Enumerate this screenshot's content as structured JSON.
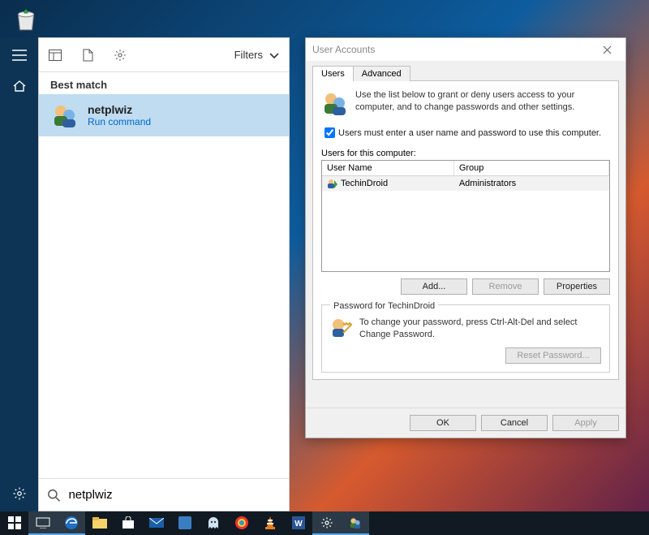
{
  "search": {
    "filters_label": "Filters",
    "best_match_label": "Best match",
    "result_title": "netplwiz",
    "result_sub": "Run command",
    "input_value": "netplwiz"
  },
  "user_accounts": {
    "title": "User Accounts",
    "tabs": {
      "users": "Users",
      "advanced": "Advanced"
    },
    "description": "Use the list below to grant or deny users access to your computer, and to change passwords and other settings.",
    "checkbox_label": "Users must enter a user name and password to use this computer.",
    "checkbox_checked": true,
    "users_label": "Users for this computer:",
    "columns": {
      "name": "User Name",
      "group": "Group"
    },
    "rows": [
      {
        "name": "TechinDroid",
        "group": "Administrators"
      }
    ],
    "buttons": {
      "add": "Add...",
      "remove": "Remove",
      "properties": "Properties"
    },
    "password_group_legend": "Password for TechinDroid",
    "password_text": "To change your password, press Ctrl-Alt-Del and select Change Password.",
    "reset_button": "Reset Password...",
    "footer": {
      "ok": "OK",
      "cancel": "Cancel",
      "apply": "Apply"
    }
  }
}
